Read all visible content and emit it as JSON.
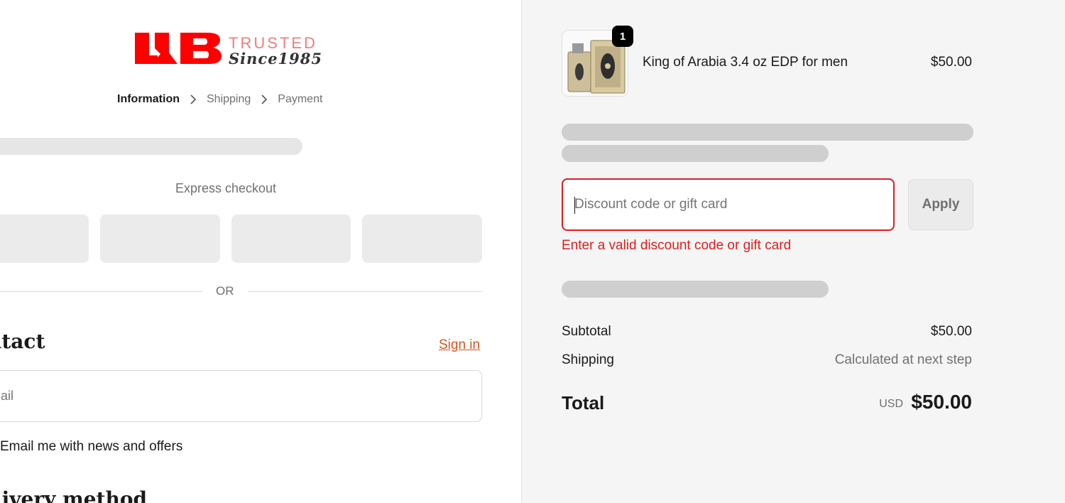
{
  "logo": {
    "trusted": "TRUSTED",
    "since": "Since1985",
    "brand_color": "#ff0000"
  },
  "breadcrumb": {
    "items": [
      "Information",
      "Shipping",
      "Payment"
    ]
  },
  "express": {
    "title": "Express checkout"
  },
  "divider": {
    "text": "OR"
  },
  "contact": {
    "title": "ntact",
    "sign_in": "Sign in",
    "email_placeholder": "ail",
    "newsletter": "Email me with news and offers"
  },
  "delivery": {
    "title": "livery method"
  },
  "cart": {
    "item_name": "King of Arabia 3.4 oz EDP for men",
    "item_price": "$50.00",
    "quantity_badge": "1"
  },
  "discount": {
    "placeholder": "Discount code or gift card",
    "apply_label": "Apply",
    "error": "Enter a valid discount code or gift card",
    "error_color": "#de1e1e"
  },
  "summary": {
    "subtotal_label": "Subtotal",
    "subtotal_value": "$50.00",
    "shipping_label": "Shipping",
    "shipping_value": "Calculated at next step",
    "total_label": "Total",
    "total_currency": "USD",
    "total_value": "$50.00"
  },
  "colors": {
    "link": "#d9531e",
    "accent": "#ff0000"
  }
}
